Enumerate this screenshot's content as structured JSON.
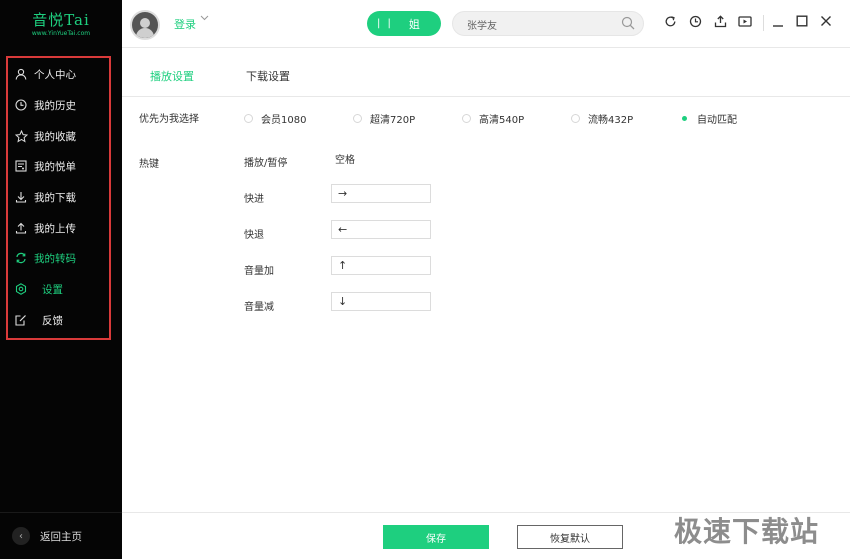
{
  "logo": {
    "main": "音悦Tai",
    "sub": "www.YinYueTai.com"
  },
  "sidebar": {
    "items": [
      {
        "label": "个人中心",
        "icon": "user-icon"
      },
      {
        "label": "我的历史",
        "icon": "clock-icon"
      },
      {
        "label": "我的收藏",
        "icon": "star-icon"
      },
      {
        "label": "我的悦单",
        "icon": "playlist-icon"
      },
      {
        "label": "我的下载",
        "icon": "download-icon"
      },
      {
        "label": "我的上传",
        "icon": "upload-icon"
      },
      {
        "label": "我的转码",
        "icon": "convert-icon"
      },
      {
        "label": "设置",
        "icon": "gear-icon"
      },
      {
        "label": "反馈",
        "icon": "feedback-icon"
      }
    ],
    "back_label": "返回主页"
  },
  "header": {
    "login_label": "登录",
    "play_text": "姐",
    "search_value": "张学友"
  },
  "tabs": [
    {
      "label": "播放设置"
    },
    {
      "label": "下载设置"
    }
  ],
  "quality": {
    "label": "优先为我选择",
    "options": [
      "会员1080",
      "超清720P",
      "高清540P",
      "流畅432P",
      "自动匹配"
    ],
    "selected": "自动匹配"
  },
  "hotkeys": {
    "label": "热键",
    "play_pause": {
      "label": "播放/暂停",
      "value": "空格"
    },
    "items": [
      {
        "label": "快进",
        "value": "→"
      },
      {
        "label": "快退",
        "value": "←"
      },
      {
        "label": "音量加",
        "value": "↑"
      },
      {
        "label": "音量减",
        "value": "↓"
      }
    ]
  },
  "footer": {
    "save_label": "保存",
    "reset_label": "恢复默认"
  },
  "watermark": "极速下载站",
  "colors": {
    "accent": "#1ecf7f",
    "sidebar_bg": "#050505",
    "highlight_border": "#d93a3a"
  }
}
